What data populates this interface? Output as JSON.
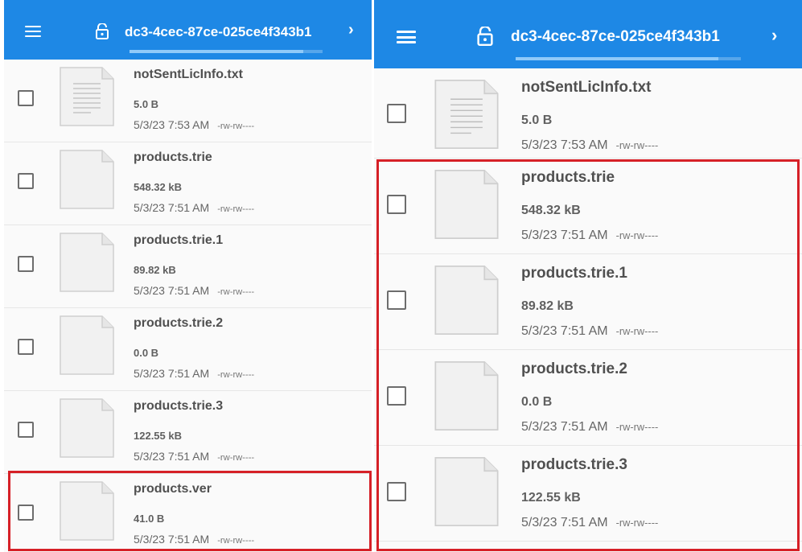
{
  "app": {
    "title": "dc3-4cec-87ce-025ce4f343b1",
    "chevron": "›",
    "accent_color": "#1e88e5",
    "progress": 0.9
  },
  "left_files": [
    {
      "name": "notSentLicInfo.txt",
      "size": "5.0 B",
      "date": "5/3/23 7:53 AM",
      "perm": "-rw-rw----",
      "icon": "text-file-icon"
    },
    {
      "name": "products.trie",
      "size": "548.32 kB",
      "date": "5/3/23 7:51 AM",
      "perm": "-rw-rw----",
      "icon": "file-icon"
    },
    {
      "name": "products.trie.1",
      "size": "89.82 kB",
      "date": "5/3/23 7:51 AM",
      "perm": "-rw-rw----",
      "icon": "file-icon"
    },
    {
      "name": "products.trie.2",
      "size": "0.0 B",
      "date": "5/3/23 7:51 AM",
      "perm": "-rw-rw----",
      "icon": "file-icon"
    },
    {
      "name": "products.trie.3",
      "size": "122.55 kB",
      "date": "5/3/23 7:51 AM",
      "perm": "-rw-rw----",
      "icon": "file-icon"
    },
    {
      "name": "products.ver",
      "size": "41.0 B",
      "date": "5/3/23 7:51 AM",
      "perm": "-rw-rw----",
      "icon": "file-icon"
    }
  ],
  "right_files": [
    {
      "name": "notSentLicInfo.txt",
      "size": "5.0 B",
      "date": "5/3/23 7:53 AM",
      "perm": "-rw-rw----",
      "icon": "text-file-icon"
    },
    {
      "name": "products.trie",
      "size": "548.32 kB",
      "date": "5/3/23 7:51 AM",
      "perm": "-rw-rw----",
      "icon": "file-icon"
    },
    {
      "name": "products.trie.1",
      "size": "89.82 kB",
      "date": "5/3/23 7:51 AM",
      "perm": "-rw-rw----",
      "icon": "file-icon"
    },
    {
      "name": "products.trie.2",
      "size": "0.0 B",
      "date": "5/3/23 7:51 AM",
      "perm": "-rw-rw----",
      "icon": "file-icon"
    },
    {
      "name": "products.trie.3",
      "size": "122.55 kB",
      "date": "5/3/23 7:51 AM",
      "perm": "-rw-rw----",
      "icon": "file-icon"
    }
  ],
  "highlight_color": "#d62027"
}
